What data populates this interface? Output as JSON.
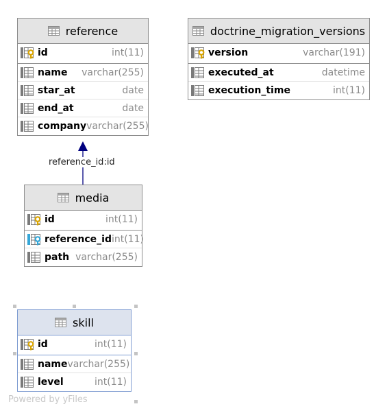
{
  "tables": {
    "reference": {
      "title": "reference",
      "columns": [
        {
          "name": "id",
          "type": "int(11)",
          "icon": "primary-key-icon"
        },
        {
          "name": "name",
          "type": "varchar(255)",
          "icon": "column-icon"
        },
        {
          "name": "star_at",
          "type": "date",
          "icon": "column-icon"
        },
        {
          "name": "end_at",
          "type": "date",
          "icon": "column-icon"
        },
        {
          "name": "company",
          "type": "varchar(255)",
          "icon": "column-icon"
        }
      ]
    },
    "doctrine_migration_versions": {
      "title": "doctrine_migration_versions",
      "columns": [
        {
          "name": "version",
          "type": "varchar(191)",
          "icon": "primary-key-icon"
        },
        {
          "name": "executed_at",
          "type": "datetime",
          "icon": "column-icon"
        },
        {
          "name": "execution_time",
          "type": "int(11)",
          "icon": "column-icon"
        }
      ]
    },
    "media": {
      "title": "media",
      "columns": [
        {
          "name": "id",
          "type": "int(11)",
          "icon": "primary-key-icon"
        },
        {
          "name": "reference_id",
          "type": "int(11)",
          "icon": "foreign-key-icon"
        },
        {
          "name": "path",
          "type": "varchar(255)",
          "icon": "column-icon"
        }
      ]
    },
    "skill": {
      "title": "skill",
      "columns": [
        {
          "name": "id",
          "type": "int(11)",
          "icon": "primary-key-icon"
        },
        {
          "name": "name",
          "type": "varchar(255)",
          "icon": "column-icon"
        },
        {
          "name": "level",
          "type": "int(11)",
          "icon": "column-icon"
        }
      ]
    }
  },
  "relations": [
    {
      "from": "media",
      "to": "reference",
      "label": "reference_id:id"
    }
  ],
  "watermark": "Powered by yFiles",
  "colors": {
    "header_bg": "#e4e4e4",
    "selected_header_bg": "#dde3ee",
    "border": "#8c8c8c",
    "selected_border": "#7d9bd1",
    "relation_line": "#00007f",
    "key_gold": "#d9a400",
    "foreign_key_blue": "#35a7d8"
  }
}
